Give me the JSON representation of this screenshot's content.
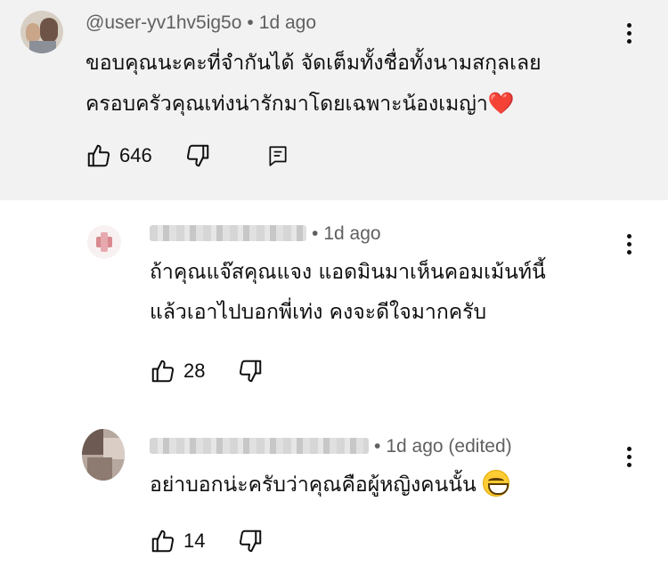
{
  "comment": {
    "username": "@user-yv1hv5ig5o",
    "separator": "•",
    "time": "1d ago",
    "text_line1": "ขอบคุณนะคะที่จำกันได้ จัดเต็มทั้งชื่อทั้งนามสกุลเลย",
    "text_line2": "ครอบครัวคุณเท่งน่ารักมาโดยเฉพาะน้องเมญ่า",
    "emoji": "❤️",
    "likes": "646"
  },
  "replies": [
    {
      "separator": "•",
      "time": "1d ago",
      "text_line1": "ถ้าคุณแจ๊สคุณแจง แอดมินมาเห็นคอมเม้นท์นี้",
      "text_line2": "แล้วเอาไปบอกพี่เท่ง คงจะดีใจมากครับ",
      "likes": "28"
    },
    {
      "separator": "•",
      "time": "1d ago (edited)",
      "text_line1": "อย่าบอกน่ะครับว่าคุณคือผู้หญิงคนนั้น",
      "emoji_name": "grinning-face-icon",
      "likes": "14"
    }
  ],
  "icons": {
    "like": "thumbs-up-icon",
    "dislike": "thumbs-down-icon",
    "reply": "reply-icon",
    "more": "more-vertical-icon"
  }
}
